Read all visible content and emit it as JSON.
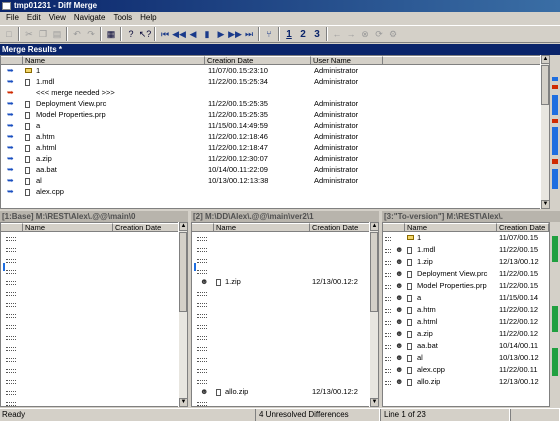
{
  "window": {
    "title": "tmp01231 - Diff Merge"
  },
  "menu": [
    "File",
    "Edit",
    "View",
    "Navigate",
    "Tools",
    "Help"
  ],
  "toolbar": {
    "icons": [
      "new-icon",
      "cut-icon",
      "copy-icon",
      "paste-icon",
      "undo-icon",
      "redo-icon",
      "print-icon",
      "help-icon",
      "context-help-icon",
      "first-diff-icon",
      "prev-conflict-icon",
      "prev-diff-icon",
      "current-icon",
      "next-diff-icon",
      "next-conflict-icon",
      "last-diff-icon",
      "merge-icon",
      "back-icon",
      "forward-icon",
      "stop-icon",
      "refresh-icon",
      "options-icon"
    ],
    "contributor_labels": [
      "1",
      "2",
      "3"
    ]
  },
  "merge_results": {
    "title": "Merge Results *",
    "columns": [
      "Name",
      "Creation Date",
      "User Name"
    ],
    "rows": [
      {
        "name": "1",
        "date": "11/07/00.15:23:10",
        "user": "Administrator",
        "icon": "folder",
        "arrow": "blue"
      },
      {
        "name": "1.mdl",
        "date": "11/22/00.15:25:34",
        "user": "Administrator",
        "icon": "file",
        "arrow": "blue"
      },
      {
        "name": "<<< merge needed >>>",
        "date": "",
        "user": "",
        "icon": "none",
        "arrow": "red"
      },
      {
        "name": "Deployment View.prc",
        "date": "11/22/00.15:25:35",
        "user": "Administrator",
        "icon": "file",
        "arrow": "blue"
      },
      {
        "name": "Model Properties.prp",
        "date": "11/22/00.15:25:35",
        "user": "Administrator",
        "icon": "file",
        "arrow": "blue"
      },
      {
        "name": "a",
        "date": "11/15/00.14:49:59",
        "user": "Administrator",
        "icon": "file",
        "arrow": "blue"
      },
      {
        "name": "a.htm",
        "date": "11/22/00.12:18:46",
        "user": "Administrator",
        "icon": "file",
        "arrow": "blue"
      },
      {
        "name": "a.html",
        "date": "11/22/00.12:18:47",
        "user": "Administrator",
        "icon": "file",
        "arrow": "blue"
      },
      {
        "name": "a.zip",
        "date": "11/22/00.12:30:07",
        "user": "Administrator",
        "icon": "file",
        "arrow": "blue"
      },
      {
        "name": "aa.bat",
        "date": "10/14/00.11:22:09",
        "user": "Administrator",
        "icon": "file",
        "arrow": "blue"
      },
      {
        "name": "al",
        "date": "10/13/00.12:13:38",
        "user": "Administrator",
        "icon": "file",
        "arrow": "blue"
      },
      {
        "name": "alex.cpp",
        "date": "",
        "user": "",
        "icon": "file",
        "arrow": "blue"
      }
    ]
  },
  "contributors": [
    {
      "title": "[1:Base] M:\\REST\\Alex\\.@@\\main\\0",
      "columns": [
        "Name",
        "Creation Date"
      ],
      "rows": []
    },
    {
      "title": "[2] M:\\DD\\Alex\\.@@\\main\\ver2\\1",
      "columns": [
        "Name",
        "Creation Date"
      ],
      "rows": [
        {
          "name": "1.zip",
          "date": "12/13/00.12:2"
        },
        {
          "name": "allo.zip",
          "date": "12/13/00.12:2"
        }
      ]
    },
    {
      "title": "[3:\"To-version\"] M:\\REST\\Alex\\.",
      "columns": [
        "Name",
        "Creation Date"
      ],
      "rows": [
        {
          "name": "1",
          "date": "11/07/00.15",
          "icon": "folder"
        },
        {
          "name": "1.mdl",
          "date": "11/22/00.15",
          "icon": "file"
        },
        {
          "name": "1.zip",
          "date": "12/13/00.12",
          "icon": "file"
        },
        {
          "name": "Deployment View.prc",
          "date": "11/22/00.15",
          "icon": "file"
        },
        {
          "name": "Model Properties.prp",
          "date": "11/22/00.15",
          "icon": "file"
        },
        {
          "name": "a",
          "date": "11/15/00.14",
          "icon": "file"
        },
        {
          "name": "a.htm",
          "date": "11/22/00.12",
          "icon": "file"
        },
        {
          "name": "a.html",
          "date": "11/22/00.12",
          "icon": "file"
        },
        {
          "name": "a.zip",
          "date": "11/22/00.12",
          "icon": "file"
        },
        {
          "name": "aa.bat",
          "date": "10/14/00.11",
          "icon": "file"
        },
        {
          "name": "al",
          "date": "10/13/00.12",
          "icon": "file"
        },
        {
          "name": "alex.cpp",
          "date": "11/22/00.11",
          "icon": "file"
        },
        {
          "name": "allo.zip",
          "date": "12/13/00.12",
          "icon": "file"
        }
      ]
    }
  ],
  "status": {
    "ready": "Ready",
    "unresolved": "4 Unresolved Differences",
    "position": "Line 1 of 23"
  }
}
